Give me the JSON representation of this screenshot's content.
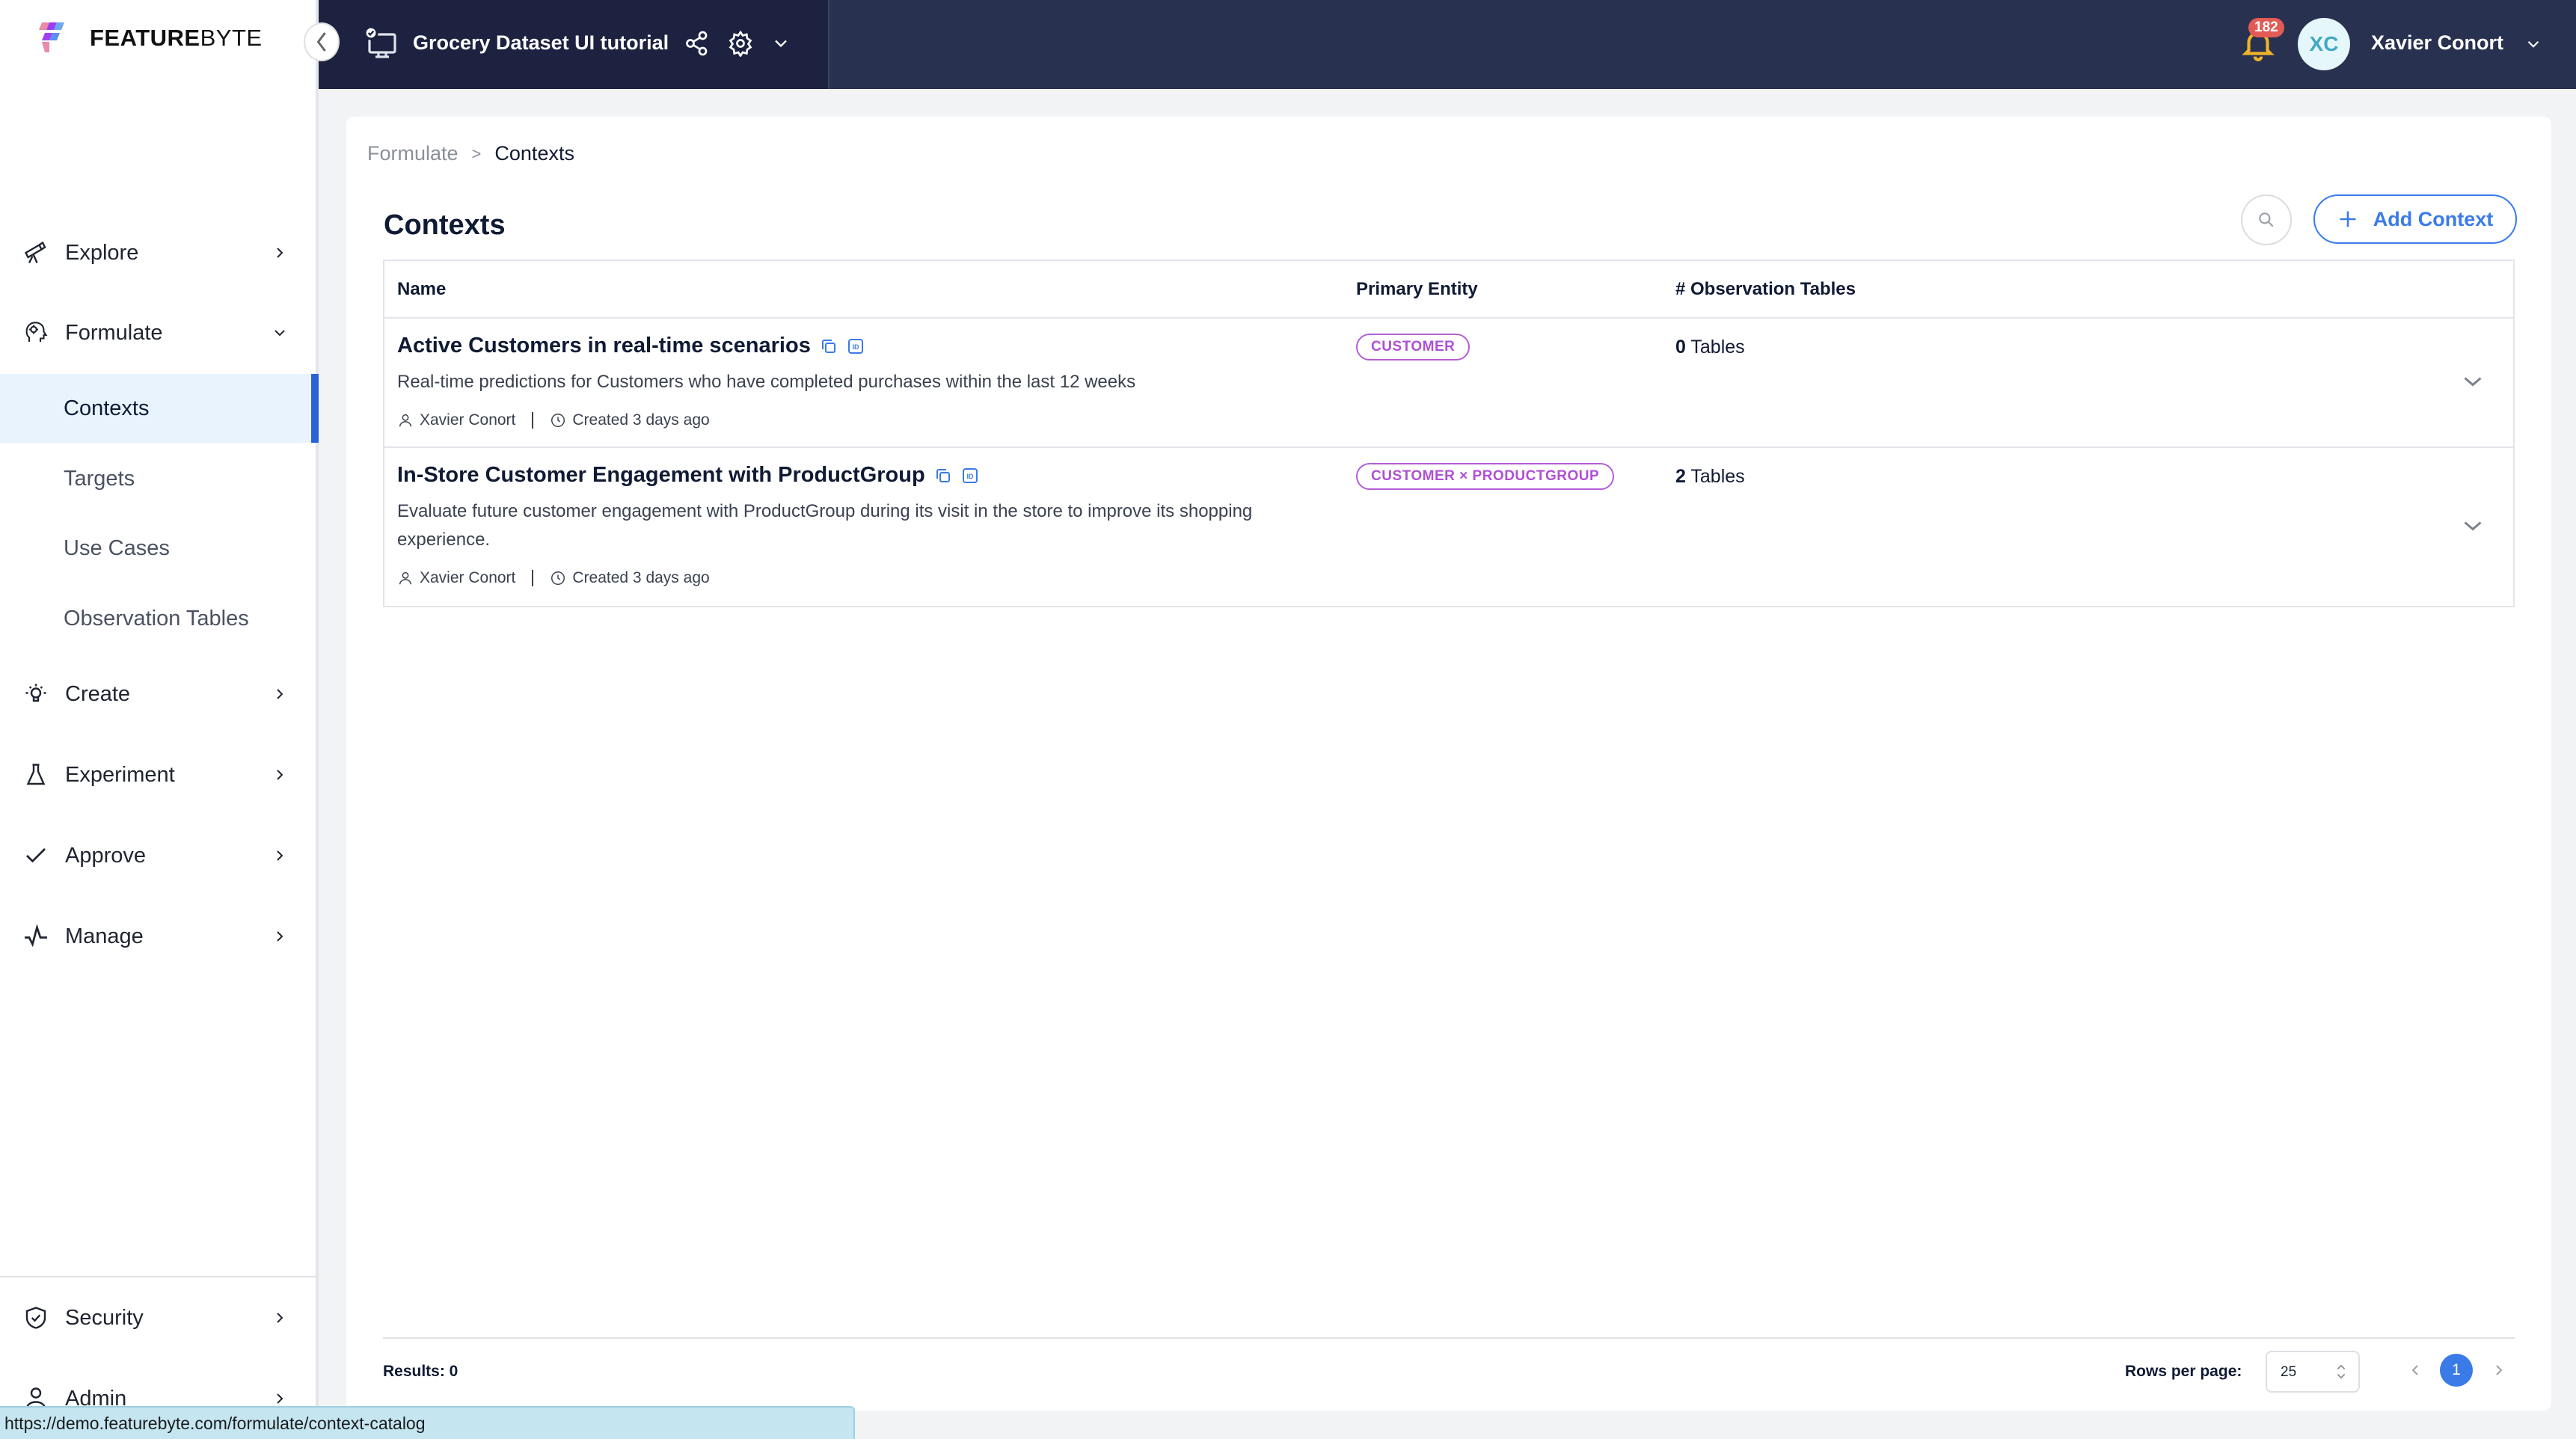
{
  "app": {
    "logo_bold": "FEATURE",
    "logo_light": "BYTE"
  },
  "header": {
    "project_title": "Grocery Dataset UI tutorial",
    "notification_count": "182",
    "user_initials": "XC",
    "user_name": "Xavier Conort"
  },
  "sidebar": {
    "items": [
      {
        "label": "Explore",
        "icon": "telescope-icon"
      },
      {
        "label": "Formulate",
        "icon": "head-gear-icon",
        "expanded": true
      },
      {
        "label": "Create",
        "icon": "lightbulb-icon"
      },
      {
        "label": "Experiment",
        "icon": "flask-icon"
      },
      {
        "label": "Approve",
        "icon": "check-icon"
      },
      {
        "label": "Manage",
        "icon": "pulse-icon"
      }
    ],
    "sub_items": [
      {
        "label": "Contexts",
        "active": true
      },
      {
        "label": "Targets"
      },
      {
        "label": "Use Cases"
      },
      {
        "label": "Observation Tables"
      }
    ],
    "bottom_items": [
      {
        "label": "Security",
        "icon": "shield-check-icon"
      },
      {
        "label": "Admin",
        "icon": "users-icon"
      }
    ]
  },
  "breadcrumb": {
    "parent": "Formulate",
    "separator": ">",
    "current": "Contexts"
  },
  "page": {
    "title": "Contexts",
    "add_button_label": "Add Context"
  },
  "table": {
    "columns": [
      "Name",
      "Primary Entity",
      "# Observation Tables"
    ],
    "rows": [
      {
        "name": "Active Customers in real-time scenarios",
        "description": "Real-time predictions for Customers who have completed purchases within the last 12 weeks",
        "owner": "Xavier Conort",
        "created": "Created 3 days ago",
        "entity": "CUSTOMER",
        "obs_count": "0",
        "obs_unit": "Tables"
      },
      {
        "name": "In-Store Customer Engagement with ProductGroup",
        "description": "Evaluate future customer engagement with ProductGroup during its visit in the store to improve its shopping experience.",
        "owner": "Xavier Conort",
        "created": "Created 3 days ago",
        "entity": "CUSTOMER × PRODUCTGROUP",
        "obs_count": "2",
        "obs_unit": "Tables"
      }
    ]
  },
  "footer": {
    "results_label": "Results: 0",
    "rows_per_page_label": "Rows per page:",
    "rows_per_page_value": "25",
    "current_page": "1"
  },
  "status_bar": {
    "url": "https://demo.featurebyte.com/formulate/context-catalog"
  },
  "colors": {
    "accent": "#3b7be8",
    "active_nav_bar": "#2a63d9",
    "entity_badge": "#b04fd5",
    "header_bg": "#293150",
    "header_left_bg": "#1c2240",
    "notification_badge": "#e25b55",
    "bell": "#f0b429"
  }
}
